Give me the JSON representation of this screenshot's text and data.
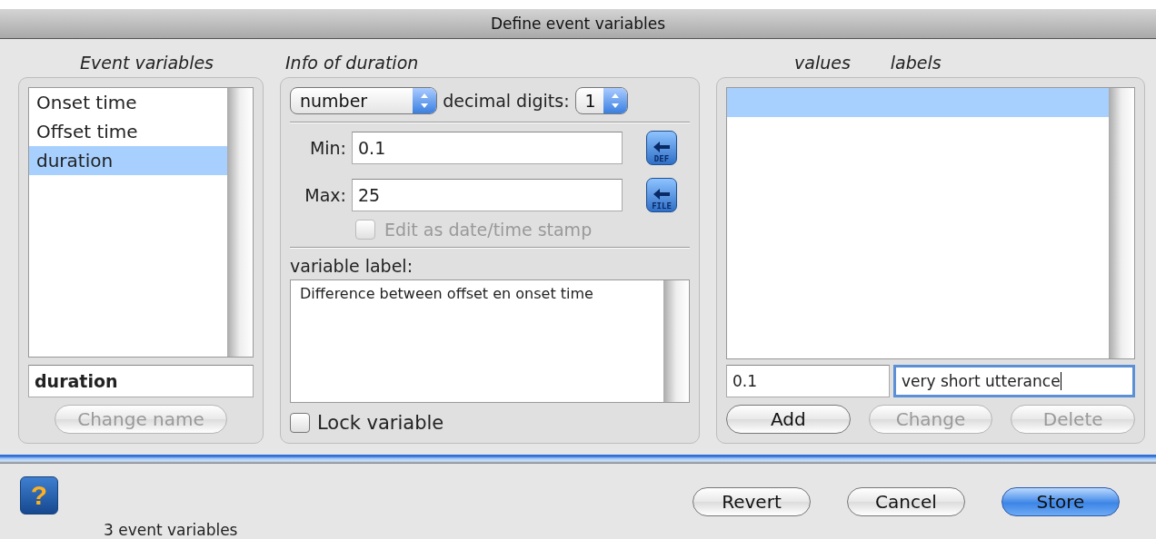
{
  "window": {
    "title": "Define event variables"
  },
  "event_variables": {
    "heading": "Event variables",
    "items": [
      {
        "label": "Onset time",
        "selected": false
      },
      {
        "label": "Offset time",
        "selected": false
      },
      {
        "label": "duration",
        "selected": true
      }
    ],
    "name_field": {
      "value": "duration"
    },
    "change_button": {
      "label": "Change name",
      "disabled": true
    }
  },
  "info": {
    "heading": "Info of duration",
    "type_select": {
      "value": "number"
    },
    "decimal_label": "decimal digits:",
    "decimal_select": {
      "value": "1"
    },
    "min": {
      "label": "Min:",
      "value": "0.1",
      "button": "DEF"
    },
    "max": {
      "label": "Max:",
      "value": "25",
      "button": "FILE"
    },
    "date_checkbox": {
      "label": "Edit as date/time stamp",
      "checked": false,
      "disabled": true
    },
    "variable_label": {
      "label": "variable label:",
      "value": "Difference between offset en onset time"
    },
    "lock_checkbox": {
      "label": "Lock variable",
      "checked": false,
      "disabled": false
    }
  },
  "value_labels": {
    "headings": [
      "values",
      "labels"
    ],
    "rows": [
      {
        "selected": true
      }
    ],
    "value_field": {
      "value": "0.1"
    },
    "label_field": {
      "value": "very short utterance",
      "focused": true
    },
    "buttons": [
      {
        "label": "Add",
        "disabled": false
      },
      {
        "label": "Change",
        "disabled": true
      },
      {
        "label": "Delete",
        "disabled": true
      }
    ]
  },
  "help_button": {
    "label": "?"
  },
  "footer_buttons": [
    {
      "label": "Revert",
      "kind": "normal"
    },
    {
      "label": "Cancel",
      "kind": "normal"
    },
    {
      "label": "Store",
      "kind": "default"
    }
  ],
  "status_bar": "3 event variables"
}
